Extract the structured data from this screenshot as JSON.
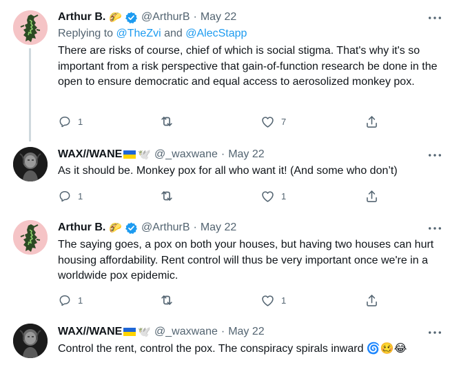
{
  "tweets": [
    {
      "name": "Arthur B.",
      "name_emoji": "🌮",
      "handle": "@ArthurB",
      "sep": "·",
      "date": "May 22",
      "replying_prefix": "Replying to ",
      "replying_1": "@TheZvi",
      "replying_and": " and ",
      "replying_2": "@AlecStapp",
      "text": "There are risks of course, chief of which is social stigma. That's why it's so important from a risk perspective that gain-of-function research be done in the open to ensure democratic and equal access to aerosolized monkey pox.",
      "replies": "1",
      "retweets": "",
      "likes": "7"
    },
    {
      "name": "WAX//WANE",
      "name_emoji": "🕊️",
      "handle": "@_waxwane",
      "sep": "·",
      "date": "May 22",
      "text": "As it should be. Monkey pox for all who want it! (And some who don’t)",
      "replies": "1",
      "retweets": "",
      "likes": "1"
    },
    {
      "name": "Arthur B.",
      "name_emoji": "🌮",
      "handle": "@ArthurB",
      "sep": "·",
      "date": "May 22",
      "text": "The saying goes, a pox on both your houses, but having two houses can hurt housing affordability. Rent control will thus be very important once we're in a worldwide pox epidemic.",
      "replies": "1",
      "retweets": "",
      "likes": "1"
    },
    {
      "name": "WAX//WANE",
      "name_emoji": "🕊️",
      "handle": "@_waxwane",
      "sep": "·",
      "date": "May 22",
      "text": "Control the rent, control the pox. The conspiracy spirals inward 🌀🥴😂"
    }
  ],
  "colors": {
    "text": "#0f1419",
    "secondary": "#536471",
    "link": "#1d9bf0",
    "thread_line": "#cfd9de"
  },
  "icons": [
    "verified-badge-icon",
    "more-icon",
    "reply-icon",
    "retweet-icon",
    "like-icon",
    "share-icon",
    "ukraine-flag-icon"
  ]
}
